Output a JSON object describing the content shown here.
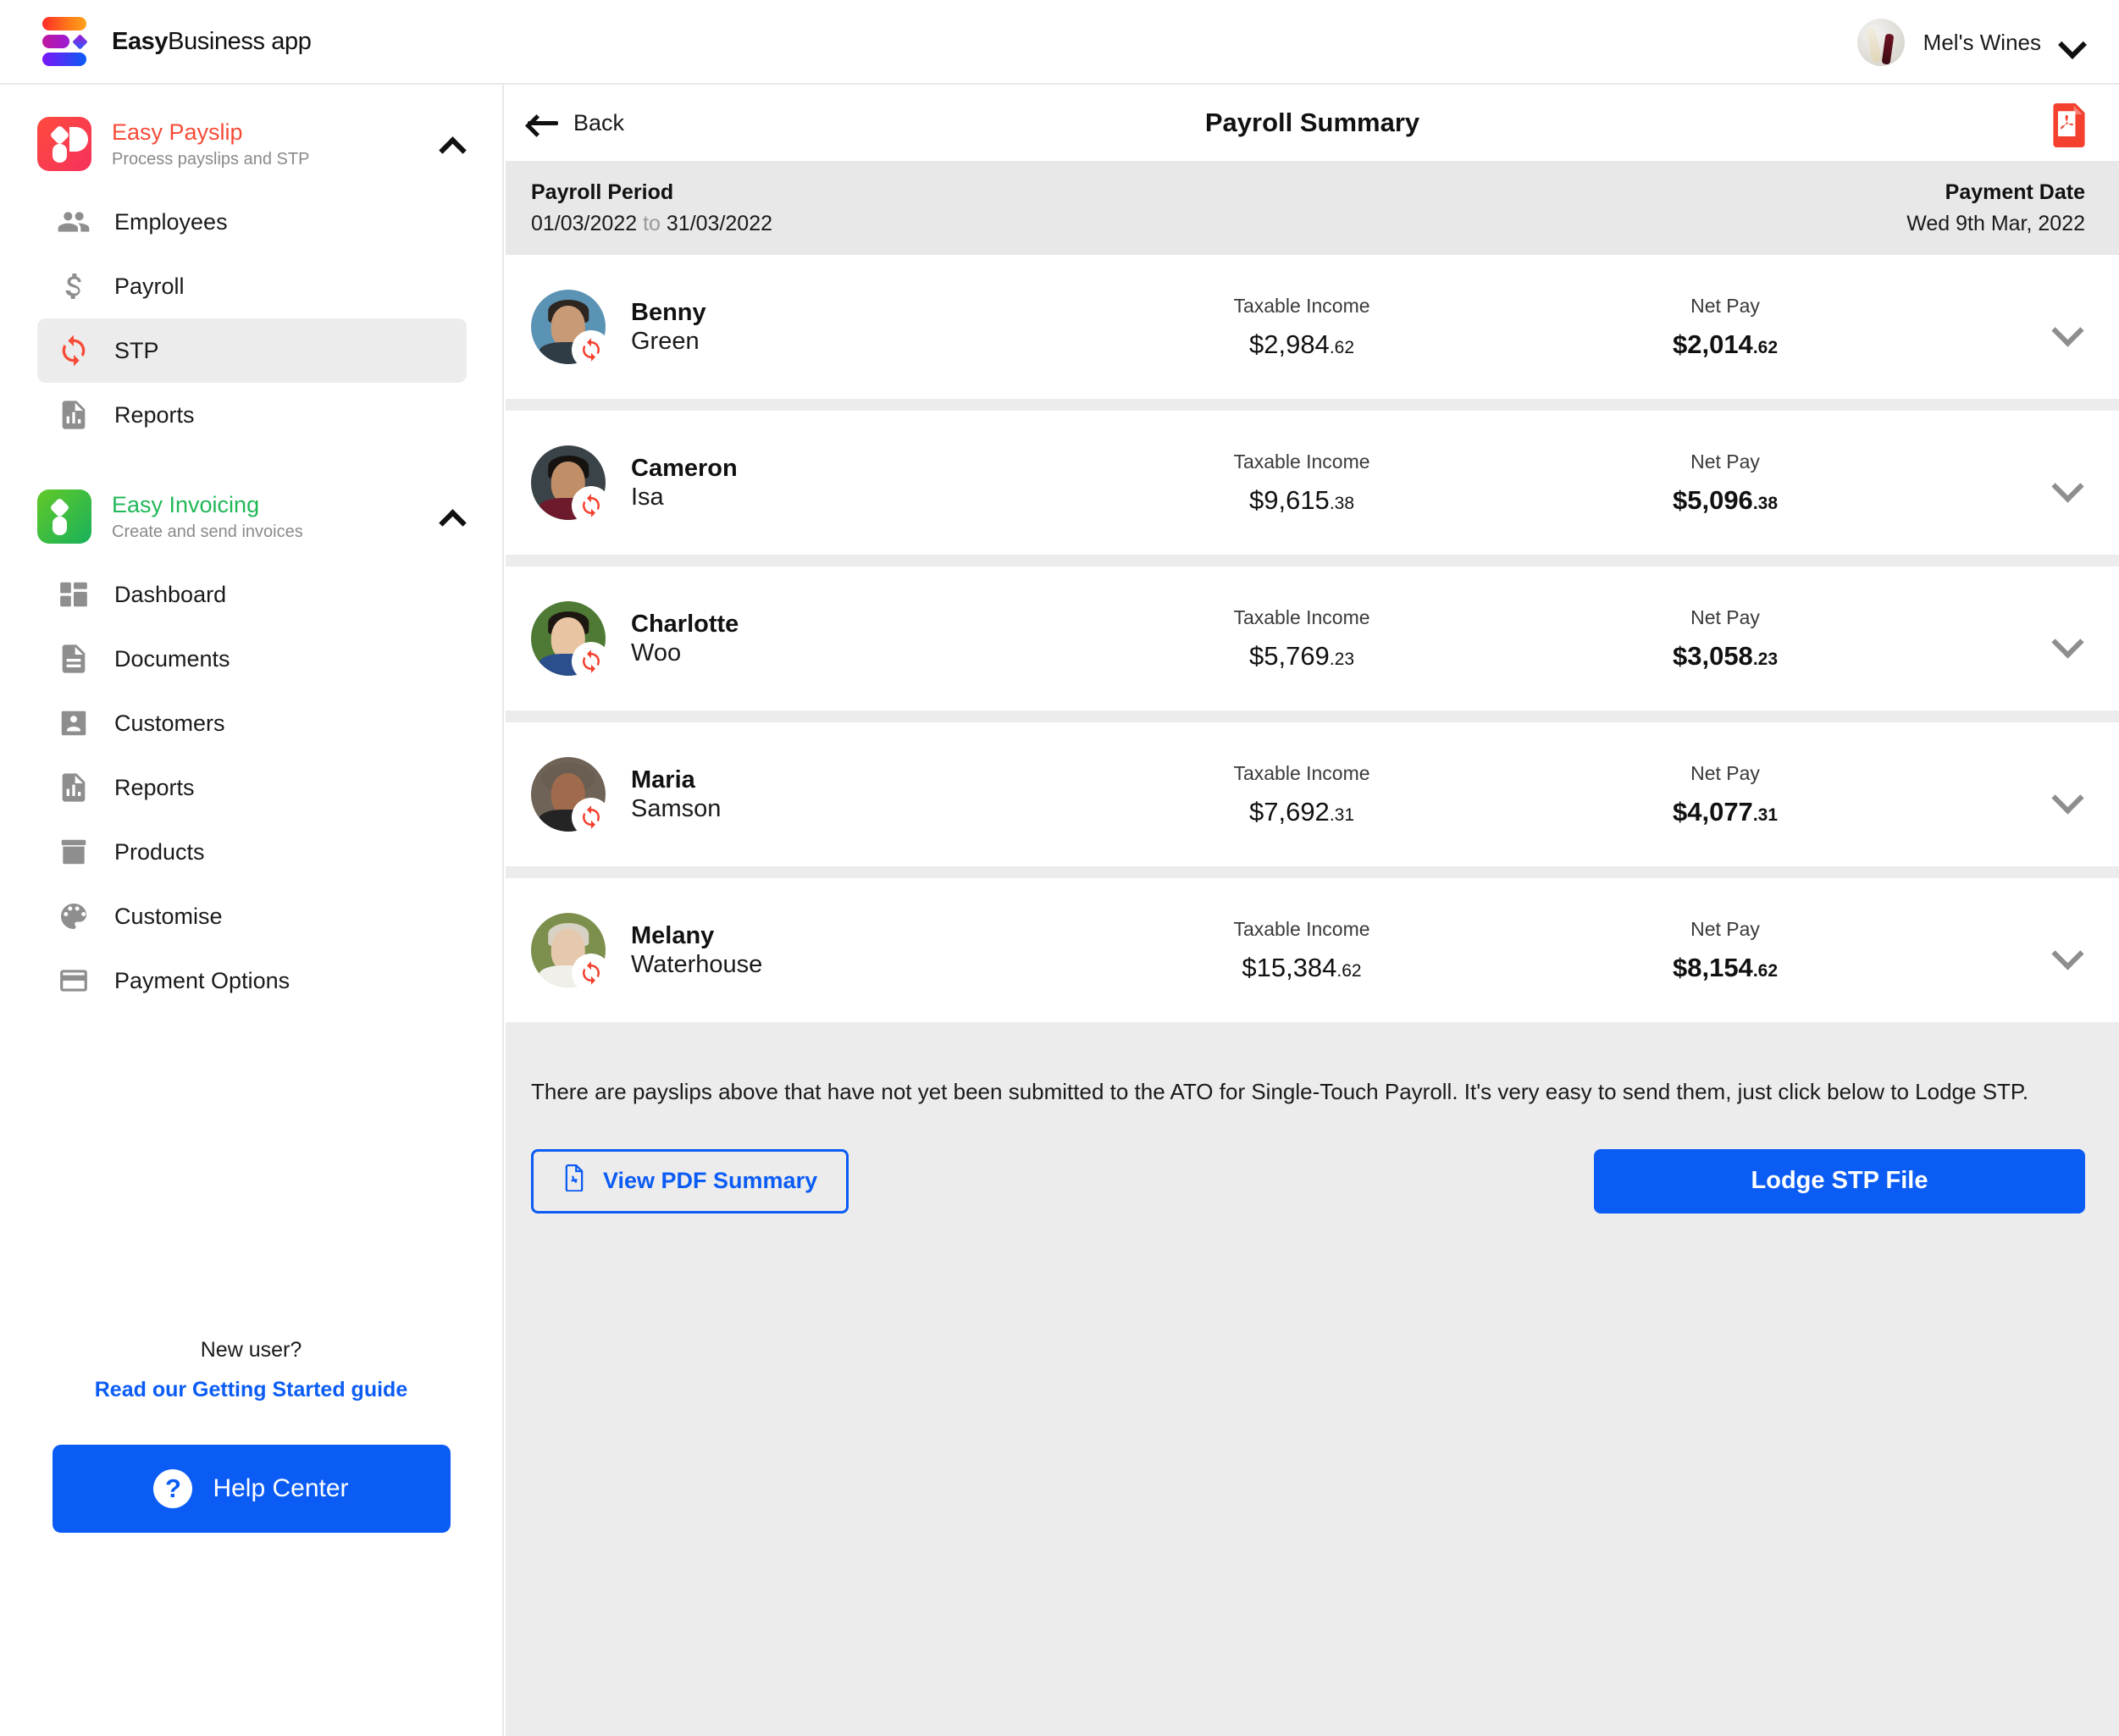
{
  "brand": {
    "name_bold": "Easy",
    "name_light": "Business app",
    "logo_icon": "easy-business-logo"
  },
  "account": {
    "name": "Mel's Wines",
    "avatar_icon": "company-avatar",
    "chevron_icon": "chevron-down-icon"
  },
  "sidebar": {
    "groups": [
      {
        "title": "Easy Payslip",
        "subtitle": "Process payslips and STP",
        "app_icon": "easy-payslip-icon",
        "collapse_icon": "chevron-up-icon",
        "accent": "#f64b38",
        "items": [
          {
            "label": "Employees",
            "icon": "people-icon",
            "active": false
          },
          {
            "label": "Payroll",
            "icon": "dollar-icon",
            "active": false
          },
          {
            "label": "STP",
            "icon": "sync-icon",
            "active": true
          },
          {
            "label": "Reports",
            "icon": "report-document-icon",
            "active": false
          }
        ]
      },
      {
        "title": "Easy Invoicing",
        "subtitle": "Create and send invoices",
        "app_icon": "easy-invoicing-icon",
        "collapse_icon": "chevron-up-icon",
        "accent": "#21b858",
        "items": [
          {
            "label": "Dashboard",
            "icon": "dashboard-grid-icon",
            "active": false
          },
          {
            "label": "Documents",
            "icon": "document-icon",
            "active": false
          },
          {
            "label": "Customers",
            "icon": "contact-card-icon",
            "active": false
          },
          {
            "label": "Reports",
            "icon": "report-document-icon",
            "active": false
          },
          {
            "label": "Products",
            "icon": "box-icon",
            "active": false
          },
          {
            "label": "Customise",
            "icon": "palette-icon",
            "active": false
          },
          {
            "label": "Payment Options",
            "icon": "credit-card-icon",
            "active": false
          }
        ]
      }
    ],
    "footer": {
      "new_user_text": "New user?",
      "guide_link": "Read our Getting Started guide",
      "help_button": "Help Center",
      "help_icon": "question-mark-icon"
    }
  },
  "main": {
    "back_label": "Back",
    "back_icon": "arrow-left-icon",
    "title": "Payroll Summary",
    "pdf_icon": "pdf-document-icon",
    "period": {
      "label": "Payroll Period",
      "start": "01/03/2022",
      "to_word": "to",
      "end": "31/03/2022",
      "payment_date_label": "Payment Date",
      "payment_date": "Wed 9th Mar, 2022"
    },
    "column_labels": {
      "taxable_income": "Taxable Income",
      "net_pay": "Net Pay"
    },
    "employees": [
      {
        "first_name": "Benny",
        "last_name": "Green",
        "avatar_class": "av-benny",
        "badge_icon": "sync-icon",
        "taxable_income_dollars": "$2,984",
        "taxable_income_cents": ".62",
        "net_pay_dollars": "$2,014",
        "net_pay_cents": ".62",
        "expand_icon": "chevron-down-icon"
      },
      {
        "first_name": "Cameron",
        "last_name": "Isa",
        "avatar_class": "av-cameron",
        "badge_icon": "sync-icon",
        "taxable_income_dollars": "$9,615",
        "taxable_income_cents": ".38",
        "net_pay_dollars": "$5,096",
        "net_pay_cents": ".38",
        "expand_icon": "chevron-down-icon"
      },
      {
        "first_name": "Charlotte",
        "last_name": "Woo",
        "avatar_class": "av-charlotte",
        "badge_icon": "sync-icon",
        "taxable_income_dollars": "$5,769",
        "taxable_income_cents": ".23",
        "net_pay_dollars": "$3,058",
        "net_pay_cents": ".23",
        "expand_icon": "chevron-down-icon"
      },
      {
        "first_name": "Maria",
        "last_name": "Samson",
        "avatar_class": "av-maria",
        "badge_icon": "sync-icon",
        "taxable_income_dollars": "$7,692",
        "taxable_income_cents": ".31",
        "net_pay_dollars": "$4,077",
        "net_pay_cents": ".31",
        "expand_icon": "chevron-down-icon"
      },
      {
        "first_name": "Melany",
        "last_name": "Waterhouse",
        "avatar_class": "av-melany",
        "badge_icon": "sync-icon",
        "taxable_income_dollars": "$15,384",
        "taxable_income_cents": ".62",
        "net_pay_dollars": "$8,154",
        "net_pay_cents": ".62",
        "expand_icon": "chevron-down-icon"
      }
    ],
    "footer": {
      "note": "There are payslips above that have not yet been submitted to the ATO for Single-Touch Payroll. It's very easy to send them, just click below to Lodge STP.",
      "view_pdf_label": "View PDF Summary",
      "view_pdf_icon": "pdf-file-icon",
      "lodge_label": "Lodge STP File"
    }
  },
  "colors": {
    "primary_blue": "#0b5cf5",
    "payslip_red": "#f64b38",
    "invoicing_green": "#21b858",
    "panel_gray": "#ececec",
    "pdf_red": "#f4402f"
  }
}
